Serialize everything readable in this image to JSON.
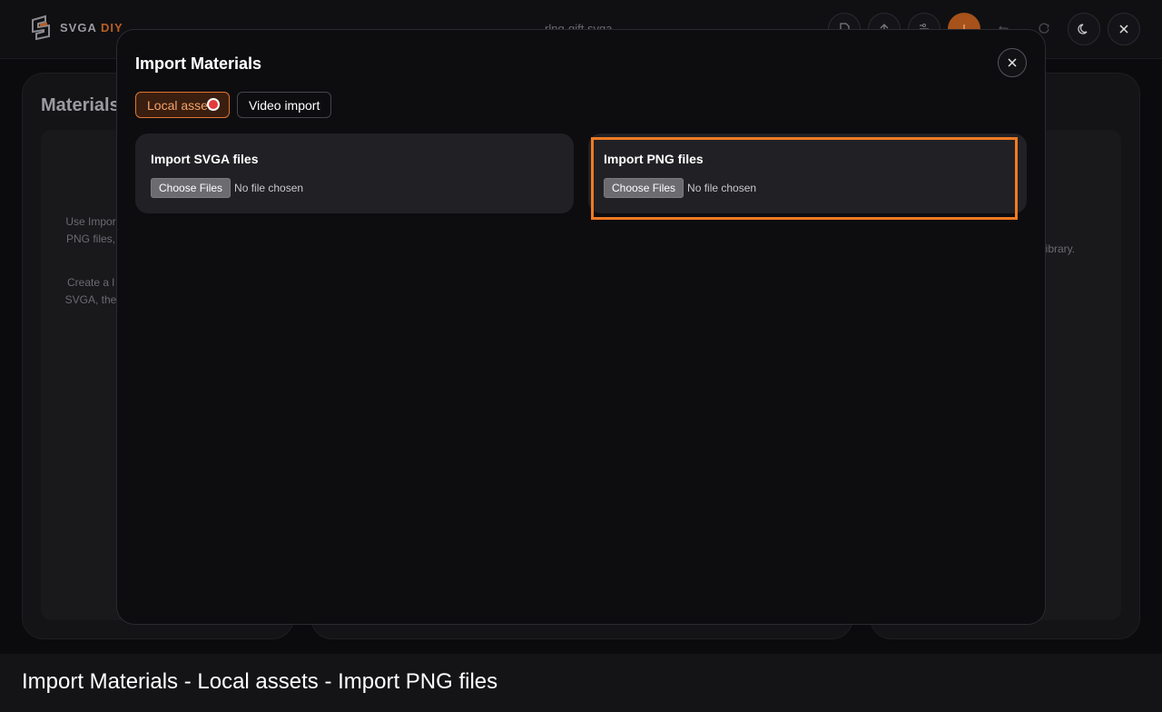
{
  "app": {
    "logo_text": "SVGA",
    "logo_suffix": "DIY",
    "document_title": "rlng-gift.svga",
    "icons": {
      "new": "file-icon",
      "upload": "upload-icon",
      "layers": "layers-icon",
      "export": "download-icon",
      "undo": "undo-icon",
      "redo": "redo-icon",
      "theme": "moon-icon",
      "close": "close-icon"
    },
    "accent_color": "#f07a22"
  },
  "background": {
    "left_panel_title": "Materials",
    "left_hint_1_line1": "Use Impor",
    "left_hint_1_line2": "PNG files,",
    "left_hint_2_line1": "Create a l",
    "left_hint_2_line2": "SVGA, the",
    "right_hint": "library."
  },
  "modal": {
    "title": "Import Materials",
    "tabs": [
      {
        "label": "Local assets",
        "active": true
      },
      {
        "label": "Video import",
        "active": false
      }
    ],
    "cards": [
      {
        "title": "Import SVGA files",
        "button": "Choose Files",
        "status": "No file chosen"
      },
      {
        "title": "Import PNG files",
        "button": "Choose Files",
        "status": "No file chosen"
      }
    ]
  },
  "caption": "Import Materials - Local assets - Import PNG files"
}
